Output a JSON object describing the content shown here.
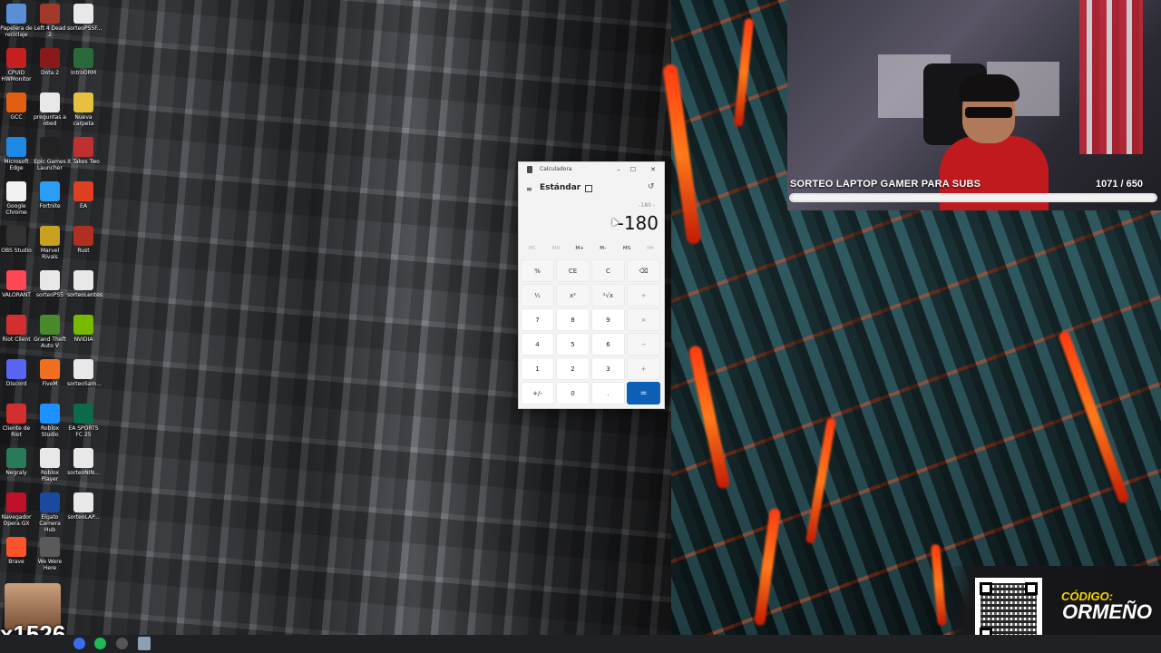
{
  "desktop_icons": [
    {
      "label": "Papelera de reciclaje",
      "icon": "recycle-bin-icon"
    },
    {
      "label": "Left 4 Dead 2",
      "icon": "left4dead-icon"
    },
    {
      "label": "sorteoPS5F...",
      "icon": "file-icon"
    },
    {
      "label": "CPUID HWMonitor",
      "icon": "hwmonitor-icon"
    },
    {
      "label": "Dota 2",
      "icon": "dota-icon"
    },
    {
      "label": "IntroORM",
      "icon": "video-icon"
    },
    {
      "label": "GCC",
      "icon": "gcc-icon"
    },
    {
      "label": "preguntas a obed",
      "icon": "file-icon"
    },
    {
      "label": "Nueva carpeta",
      "icon": "folder-icon"
    },
    {
      "label": "Microsoft Edge",
      "icon": "edge-icon"
    },
    {
      "label": "Epic Games Launcher",
      "icon": "epic-icon"
    },
    {
      "label": "It Takes Two",
      "icon": "ittakestwo-icon"
    },
    {
      "label": "Google Chrome",
      "icon": "chrome-icon"
    },
    {
      "label": "Fortnite",
      "icon": "fortnite-icon"
    },
    {
      "label": "EA",
      "icon": "ea-icon"
    },
    {
      "label": "OBS Studio",
      "icon": "obs-icon"
    },
    {
      "label": "Marvel Rivals",
      "icon": "marvel-rivals-icon"
    },
    {
      "label": "Rust",
      "icon": "rust-icon"
    },
    {
      "label": "VALORANT",
      "icon": "valorant-icon"
    },
    {
      "label": "sorteoPS5",
      "icon": "file-icon"
    },
    {
      "label": "sorteoLentes",
      "icon": "file-icon"
    },
    {
      "label": "Riot Client",
      "icon": "riot-icon"
    },
    {
      "label": "Grand Theft Auto V",
      "icon": "gta-icon"
    },
    {
      "label": "NVIDIA",
      "icon": "nvidia-icon"
    },
    {
      "label": "Discord",
      "icon": "discord-icon"
    },
    {
      "label": "FiveM",
      "icon": "fivem-icon"
    },
    {
      "label": "sorteoSam...",
      "icon": "file-icon"
    },
    {
      "label": "Cliente de Riot",
      "icon": "riot-icon"
    },
    {
      "label": "Roblox Studio",
      "icon": "roblox-studio-icon"
    },
    {
      "label": "EA SPORTS FC 25",
      "icon": "eafc-icon"
    },
    {
      "label": "Negraly",
      "icon": "app-icon"
    },
    {
      "label": "Roblox Player",
      "icon": "roblox-icon"
    },
    {
      "label": "sorteoNIN...",
      "icon": "file-icon"
    },
    {
      "label": "Navegador Opera GX",
      "icon": "opera-gx-icon"
    },
    {
      "label": "Elgato Camera Hub",
      "icon": "elgato-icon"
    },
    {
      "label": "sorteoLAP...",
      "icon": "file-icon"
    },
    {
      "label": "Brave",
      "icon": "brave-icon"
    },
    {
      "label": "We Were Here",
      "icon": "wewerehere-icon"
    }
  ],
  "stream_overlay": {
    "giveaway_title": "SORTEO LAPTOP GAMER PARA SUBS",
    "giveaway_count": "1071  / 650",
    "giveaway_progress": 1.0,
    "promo_label": "CÓDIGO:",
    "promo_code": "ORMEÑO",
    "multiplier": "x1526"
  },
  "calculator": {
    "title": "Calculadora",
    "minimize": "–",
    "maximize": "☐",
    "close": "✕",
    "menu_icon": "≡",
    "mode": "Estándar",
    "history_icon": "↺",
    "expression": "-180 -",
    "display": "-180",
    "memory": [
      "MC",
      "MR",
      "M+",
      "M–",
      "MS",
      "M▾"
    ],
    "keys": [
      "%",
      "CE",
      "C",
      "⌫",
      "¹⁄ₓ",
      "x²",
      "²√x",
      "÷",
      "7",
      "8",
      "9",
      "×",
      "4",
      "5",
      "6",
      "−",
      "1",
      "2",
      "3",
      "+",
      "+/-",
      "0",
      ".",
      "="
    ]
  },
  "colors": {
    "accent_equals": "#0b5fb5",
    "promo_label": "#f5d400"
  }
}
